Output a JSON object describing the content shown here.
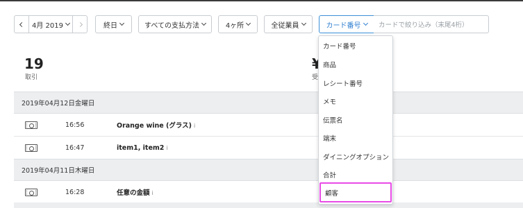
{
  "toolbar": {
    "month_label": "4月 2019",
    "time_label": "終日",
    "payment_label": "すべての支払方法",
    "locations_label": "4ヶ所",
    "staff_label": "全従業員",
    "search_field_label": "カード番号",
    "search_placeholder": "カードで絞り込み（末尾4桁）"
  },
  "stats": {
    "transactions_count": "19",
    "transactions_label": "取引",
    "sales_symbol": "¥",
    "sales_label_partial": "受"
  },
  "transactions": {
    "groups": [
      {
        "date": "2019年04月12日金曜日",
        "rows": [
          {
            "time": "16:56",
            "desc": "Orange wine (グラス)",
            "sub": "i"
          },
          {
            "time": "16:47",
            "desc": "item1, item2",
            "sub": "i"
          }
        ]
      },
      {
        "date": "2019年04月11日木曜日",
        "rows": [
          {
            "time": "16:28",
            "desc": "任意の金額",
            "sub": "i"
          }
        ]
      }
    ]
  },
  "dropdown": {
    "items": [
      "カード番号",
      "商品",
      "レシート番号",
      "メモ",
      "伝票名",
      "端末",
      "ダイニングオプション",
      "合計",
      "顧客"
    ],
    "highlighted_index": 8,
    "highlight_color": "#e84be6"
  },
  "colors": {
    "accent": "#2f7fd0",
    "header_bg": "#eceef0"
  }
}
